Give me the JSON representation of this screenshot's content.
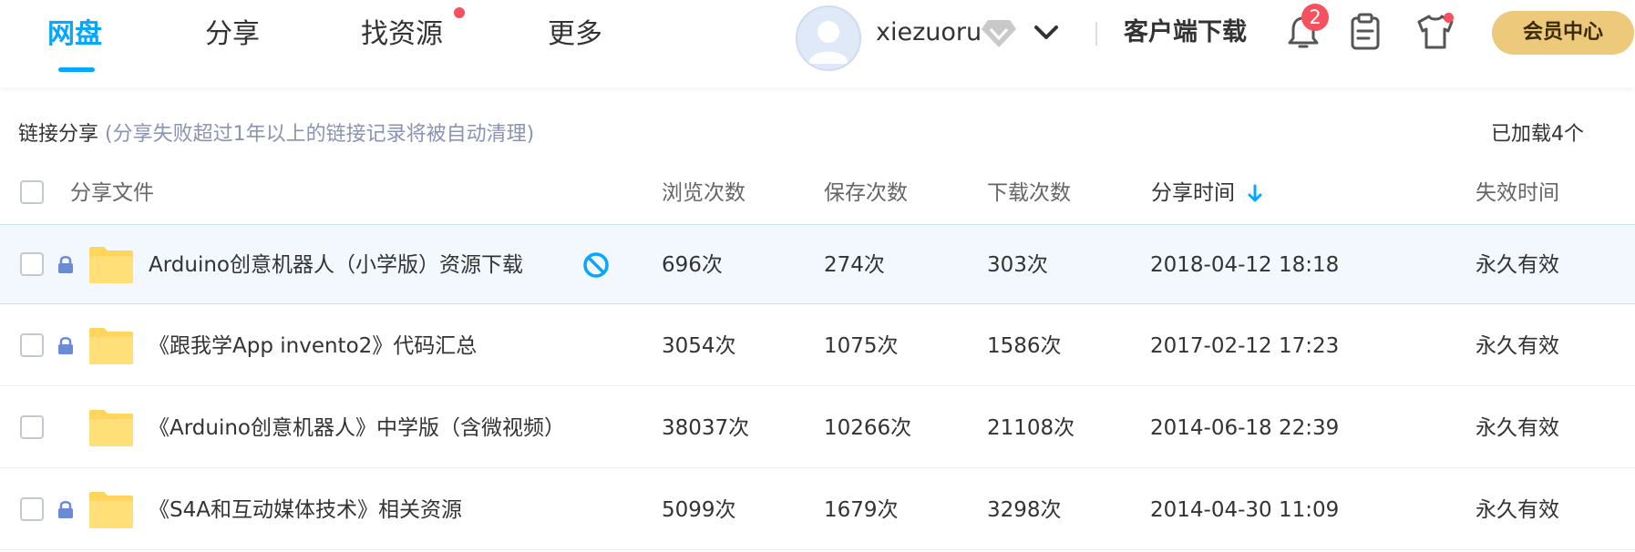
{
  "nav": {
    "tabs": [
      {
        "label": "网盘",
        "active": true
      },
      {
        "label": "分享",
        "active": false
      },
      {
        "label": "找资源",
        "active": false,
        "dot": true
      },
      {
        "label": "更多",
        "active": false
      }
    ],
    "username": "xiezuoru",
    "download_client": "客户端下载",
    "notification_count": "2",
    "vip_center": "会员中心",
    "icons": [
      "avatar",
      "diamond-icon",
      "chevron-down-icon",
      "bell-icon",
      "clipboard-icon",
      "tshirt-icon"
    ]
  },
  "section": {
    "title": "链接分享",
    "note": "(分享失败超过1年以上的链接记录将被自动清理)",
    "loaded": "已加载4个"
  },
  "table": {
    "headers": {
      "file": "分享文件",
      "views": "浏览次数",
      "saves": "保存次数",
      "downloads": "下载次数",
      "time": "分享时间",
      "expire": "失效时间"
    },
    "sort_icon": "arrow-down-icon",
    "rows": [
      {
        "name": "Arduino创意机器人（小学版）资源下载",
        "views": "696次",
        "saves": "274次",
        "downloads": "303次",
        "time": "2018-04-12 18:18",
        "expire": "永久有效",
        "locked": true,
        "banned": true
      },
      {
        "name": "《跟我学App invento2》代码汇总",
        "views": "3054次",
        "saves": "1075次",
        "downloads": "1586次",
        "time": "2017-02-12 17:23",
        "expire": "永久有效",
        "locked": true,
        "banned": false
      },
      {
        "name": "《Arduino创意机器人》中学版（含微视频）",
        "views": "38037次",
        "saves": "10266次",
        "downloads": "21108次",
        "time": "2014-06-18 22:39",
        "expire": "永久有效",
        "locked": false,
        "banned": false
      },
      {
        "name": "《S4A和互动媒体技术》相关资源",
        "views": "5099次",
        "saves": "1679次",
        "downloads": "3298次",
        "time": "2014-04-30 11:09",
        "expire": "永久有效",
        "locked": true,
        "banned": false
      }
    ]
  },
  "colors": {
    "accent": "#06a7ff",
    "badge": "#f5515f",
    "vip": "#ecc97b",
    "folder": "#ffd55c",
    "highlight_row": "#f2f8fd"
  }
}
